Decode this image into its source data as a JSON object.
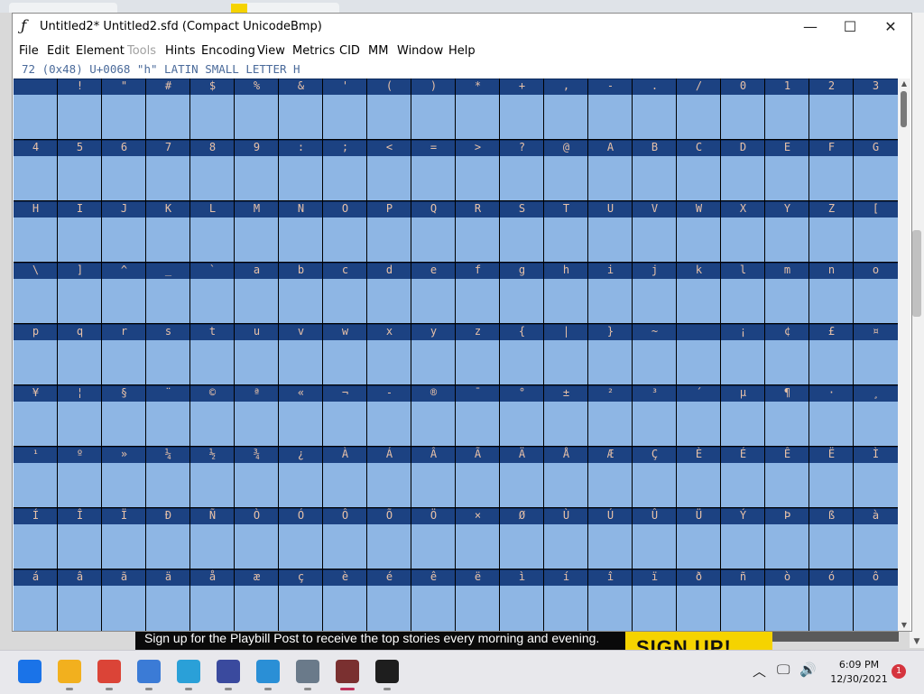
{
  "window": {
    "title": "Untitled2*  Untitled2.sfd (Compact UnicodeBmp)",
    "minimize_glyph": "—",
    "maximize_glyph": "☐",
    "close_glyph": "✕"
  },
  "menu": {
    "items": [
      {
        "label": "File",
        "enabled": true
      },
      {
        "label": "Edit",
        "enabled": true
      },
      {
        "label": "Element",
        "enabled": true
      },
      {
        "label": "Tools",
        "enabled": false
      },
      {
        "label": "Hints",
        "enabled": true
      },
      {
        "label": "Encoding",
        "enabled": true
      },
      {
        "label": "View",
        "enabled": true
      },
      {
        "label": "Metrics",
        "enabled": true
      },
      {
        "label": "CID",
        "enabled": true
      },
      {
        "label": "MM",
        "enabled": true
      },
      {
        "label": "Window",
        "enabled": true
      },
      {
        "label": "Help",
        "enabled": true
      }
    ]
  },
  "info": {
    "text": "72 (0x48) U+0068 \"h\" LATIN SMALL LETTER H"
  },
  "glyph_grid": {
    "rows": [
      [
        "",
        "!",
        "\"",
        "#",
        "$",
        "%",
        "&",
        "'",
        "(",
        ")",
        "*",
        "+",
        ",",
        "-",
        ".",
        "/",
        "0",
        "1",
        "2",
        "3"
      ],
      [
        "4",
        "5",
        "6",
        "7",
        "8",
        "9",
        ":",
        ";",
        "<",
        "=",
        ">",
        "?",
        "@",
        "A",
        "B",
        "C",
        "D",
        "E",
        "F",
        "G"
      ],
      [
        "H",
        "I",
        "J",
        "K",
        "L",
        "M",
        "N",
        "O",
        "P",
        "Q",
        "R",
        "S",
        "T",
        "U",
        "V",
        "W",
        "X",
        "Y",
        "Z",
        "["
      ],
      [
        "\\",
        "]",
        "^",
        "_",
        "`",
        "a",
        "b",
        "c",
        "d",
        "e",
        "f",
        "g",
        "h",
        "i",
        "j",
        "k",
        "l",
        "m",
        "n",
        "o"
      ],
      [
        "p",
        "q",
        "r",
        "s",
        "t",
        "u",
        "v",
        "w",
        "x",
        "y",
        "z",
        "{",
        "|",
        "}",
        "~",
        "",
        "¡",
        "¢",
        "£",
        "¤"
      ],
      [
        "¥",
        "¦",
        "§",
        "¨",
        "©",
        "ª",
        "«",
        "¬",
        "-",
        "®",
        "¯",
        "°",
        "±",
        "²",
        "³",
        "´",
        "µ",
        "¶",
        "·",
        "¸"
      ],
      [
        "¹",
        "º",
        "»",
        "¼",
        "½",
        "¾",
        "¿",
        "À",
        "Á",
        "Â",
        "Ã",
        "Ä",
        "Å",
        "Æ",
        "Ç",
        "È",
        "É",
        "Ê",
        "Ë",
        "Ì"
      ],
      [
        "Í",
        "Î",
        "Ï",
        "Ð",
        "Ñ",
        "Ò",
        "Ó",
        "Ô",
        "Õ",
        "Ö",
        "×",
        "Ø",
        "Ù",
        "Ú",
        "Û",
        "Ü",
        "Ý",
        "Þ",
        "ß",
        "à"
      ],
      [
        "á",
        "â",
        "ã",
        "ä",
        "å",
        "æ",
        "ç",
        "è",
        "é",
        "ê",
        "ë",
        "ì",
        "í",
        "î",
        "ï",
        "ð",
        "ñ",
        "ò",
        "ó",
        "ô"
      ]
    ],
    "label_color": "#e7c1a8",
    "header_color": "#1c4282",
    "cell_color": "#8eb6e4"
  },
  "background": {
    "banner_text": "Sign up for the Playbill Post to receive the top stories every morning and evening.",
    "banner_button": "SIGN UP!"
  },
  "taskbar": {
    "apps": [
      {
        "icon": "windows-start-icon",
        "color": "#1a73e8"
      },
      {
        "icon": "file-explorer-icon",
        "color": "#f2b01e"
      },
      {
        "icon": "chrome-icon",
        "color": "#db4437"
      },
      {
        "icon": "microsoft-store-icon",
        "color": "#3b7bd6"
      },
      {
        "icon": "edge-browser-icon",
        "color": "#2aa0d8"
      },
      {
        "icon": "fontforge-a-icon",
        "color": "#3a4a9e"
      },
      {
        "icon": "notepad-icon",
        "color": "#2a8fd6"
      },
      {
        "icon": "3d-cube-icon",
        "color": "#6a7a8a"
      },
      {
        "icon": "fontforge-app-icon",
        "color": "#7a3030"
      },
      {
        "icon": "terminal-icon",
        "color": "#1e1e1e"
      }
    ],
    "time": "6:09 PM",
    "date": "12/30/2021",
    "notification_count": "1"
  }
}
